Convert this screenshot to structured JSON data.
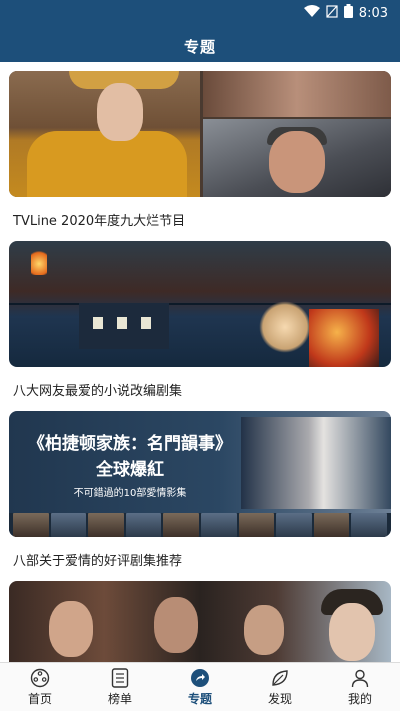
{
  "status_bar": {
    "time": "8:03",
    "icons": [
      "wifi-icon",
      "signal-icon",
      "battery-icon"
    ]
  },
  "header": {
    "title": "专题"
  },
  "cards": [
    {
      "title": "TVLine 2020年度九大烂节目"
    },
    {
      "title": "八大网友最爱的小说改编剧集"
    },
    {
      "title": "八部关于爱情的好评剧集推荐",
      "banner_line1": "《柏捷顿家族：名門韻事》",
      "banner_line2": "全球爆紅",
      "banner_line3": "不可錯過的10部愛情影集"
    },
    {
      "title": ""
    }
  ],
  "bottom_nav": {
    "active": "专题",
    "items": [
      {
        "label": "首页",
        "icon": "film-reel-icon"
      },
      {
        "label": "榜单",
        "icon": "list-icon"
      },
      {
        "label": "专题",
        "icon": "share-icon"
      },
      {
        "label": "发现",
        "icon": "leaf-icon"
      },
      {
        "label": "我的",
        "icon": "person-icon"
      }
    ]
  },
  "colors": {
    "header_bg": "#1d4f7a",
    "active_tab": "#1d4f7a",
    "text": "#222222"
  }
}
